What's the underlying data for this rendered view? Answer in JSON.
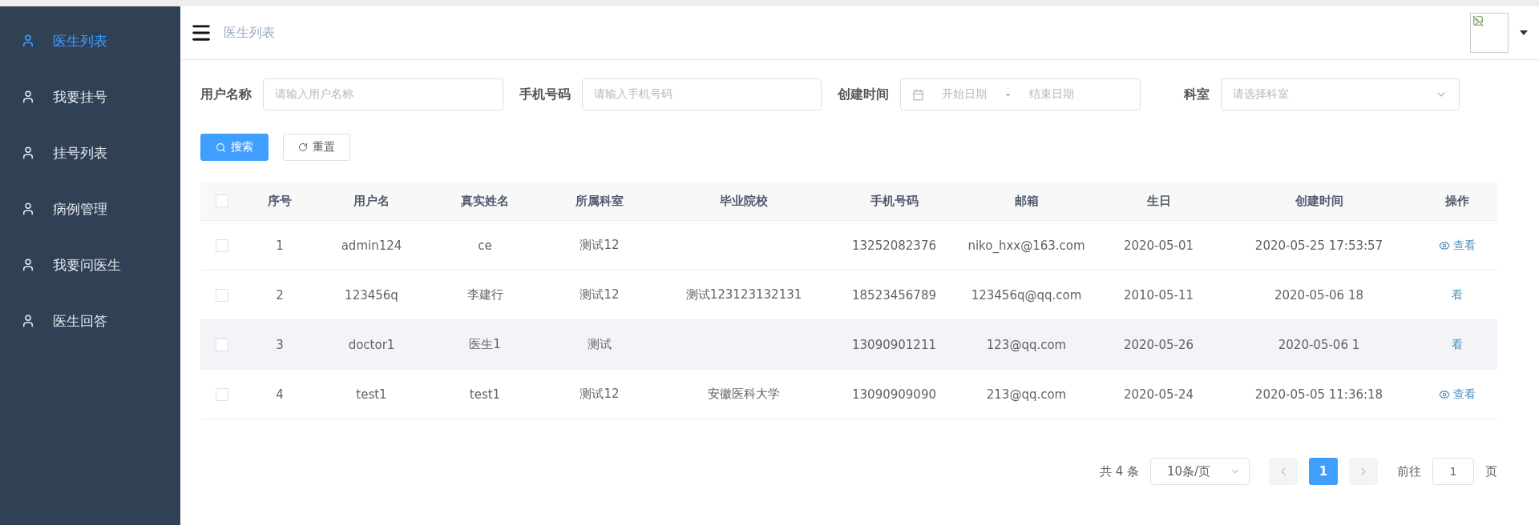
{
  "sidebar": {
    "items": [
      {
        "label": "医生列表",
        "selected": true
      },
      {
        "label": "我要挂号",
        "selected": false
      },
      {
        "label": "挂号列表",
        "selected": false
      },
      {
        "label": "病例管理",
        "selected": false
      },
      {
        "label": "我要问医生",
        "selected": false
      },
      {
        "label": "医生回答",
        "selected": false
      }
    ]
  },
  "header": {
    "breadcrumb": "医生列表"
  },
  "filters": [
    {
      "kind": "text",
      "label": "用户名称",
      "placeholder": "请输入用户名称"
    },
    {
      "kind": "text",
      "label": "手机号码",
      "placeholder": "请输入手机号码"
    },
    {
      "kind": "daterange",
      "label": "创建时间",
      "start_placeholder": "开始日期",
      "separator": "-",
      "end_placeholder": "结束日期"
    },
    {
      "kind": "select",
      "label": "科室",
      "placeholder": "请选择科室"
    }
  ],
  "buttons": [
    {
      "kind": "primary",
      "label": "搜索"
    },
    {
      "kind": "default",
      "label": "重置"
    }
  ],
  "table": {
    "header_checked": false,
    "columns": [
      "序号",
      "用户名",
      "真实姓名",
      "所属科室",
      "毕业院校",
      "手机号码",
      "邮箱",
      "生日",
      "创建时间",
      "操作"
    ],
    "rows": [
      {
        "checked": false,
        "hovered": false,
        "cells": [
          "1",
          "admin124",
          "ce",
          "测试12",
          "",
          "13252082376",
          "niko_hxx@163.com",
          "2020-05-01",
          "2020-05-25 17:53:57"
        ],
        "action": {
          "label": "查看",
          "icon": true
        }
      },
      {
        "checked": false,
        "hovered": false,
        "cells": [
          "2",
          "123456q",
          "李建行",
          "测试12",
          "测试123123132131",
          "18523456789",
          "123456q@qq.com",
          "2010-05-11",
          "2020-05-06 18"
        ],
        "action": {
          "label": "看",
          "icon": false
        }
      },
      {
        "checked": false,
        "hovered": true,
        "cells": [
          "3",
          "doctor1",
          "医生1",
          "测试",
          "",
          "13090901211",
          "123@qq.com",
          "2020-05-26",
          "2020-05-06 1"
        ],
        "action": {
          "label": "看",
          "icon": false
        }
      },
      {
        "checked": false,
        "hovered": false,
        "cells": [
          "4",
          "test1",
          "test1",
          "测试12",
          "安徽医科大学",
          "13090909090",
          "213@qq.com",
          "2020-05-24",
          "2020-05-05 11:36:18"
        ],
        "action": {
          "label": "查看",
          "icon": true
        }
      }
    ]
  },
  "pagination": {
    "total": "共 4 条",
    "page_size": "10条/页",
    "pages": [
      {
        "label": "1",
        "selected": true
      }
    ],
    "goto_label": "前往",
    "goto_value": "1",
    "goto_suffix": "页"
  }
}
